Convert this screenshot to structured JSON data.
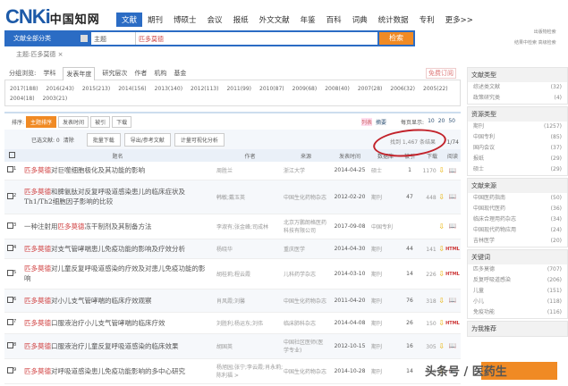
{
  "header": {
    "logo": "CNKi",
    "logo_cn": "中国知网",
    "nav": [
      "文献",
      "期刊",
      "博硕士",
      "会议",
      "报纸",
      "外文文献",
      "年鉴",
      "百科",
      "词典",
      "统计数据",
      "专利",
      "更多>>"
    ],
    "active_nav": "文献"
  },
  "search": {
    "category": "文献全部分类",
    "field": "主题",
    "query": "匹多莫德",
    "button": "检索",
    "links": [
      "出版物检索",
      "结果中检索",
      "高级检索"
    ]
  },
  "tag": "主题:匹多莫德 ×",
  "filter": {
    "label": "分组浏览:",
    "tabs": [
      "学科",
      "发表年度",
      "研究层次",
      "作者",
      "机构",
      "基金"
    ],
    "active": "发表年度",
    "years": [
      "2017(188)",
      "2016(243)",
      "2015(213)",
      "2014(156)",
      "2013(140)",
      "2012(113)",
      "2011(99)",
      "2010(87)",
      "2009(68)",
      "2008(40)",
      "2007(28)",
      "2006(32)",
      "2005(22)",
      "2004(18)",
      "2003(21)"
    ],
    "free": "免费订阅"
  },
  "sort": {
    "label": "排序:",
    "options": [
      "主题排序",
      "发表时间",
      "被引",
      "下载"
    ],
    "active": "主题排序",
    "view": [
      "列表",
      "摘要"
    ],
    "per_page_label": "每页显示:",
    "per_page": [
      "10",
      "20",
      "50"
    ]
  },
  "toolbar": {
    "selected": "已选文献: 0",
    "clear": "清除",
    "buttons": [
      "批量下载",
      "导出/参考文献",
      "计量可视化分析"
    ],
    "count": "找到 1,467 条结果",
    "page": "1/74"
  },
  "table": {
    "headers": [
      "题名",
      "作者",
      "来源",
      "发表时间",
      "数据库",
      "被引",
      "下载",
      "阅读"
    ],
    "rows": [
      {
        "n": "1",
        "kw": "匹多莫德",
        "title": "对巨噬细胞极化及其功能的影响",
        "author": "周胜兰",
        "source": "浙江大学",
        "date": "2014-04-25",
        "db": "硕士",
        "cite": "1",
        "dl": "1170",
        "read": "book"
      },
      {
        "n": "2",
        "kw": "匹多莫德",
        "title": "和脾氨肽对反复呼吸道感染患儿的临床症状及Th1/Th2细胞因子影响的比较",
        "author": "韩敏;戴玉英",
        "source": "中国生化药物杂志",
        "date": "2012-02-20",
        "db": "期刊",
        "cite": "47",
        "dl": "448",
        "read": "book"
      },
      {
        "n": "3",
        "pre": "一种注射用",
        "kw": "匹多莫德",
        "title": "冻干制剂及其制备方法",
        "author": "李淑有;张金峰;司成林",
        "source": "北京万鹏朗格医药科技有限公司",
        "date": "2017-09-08",
        "db": "中国专利",
        "cite": "",
        "dl": "",
        "read": "book"
      },
      {
        "n": "4",
        "kw": "匹多莫德",
        "title": "对支气管哮喘患儿免疫功能的影响及疗效分析",
        "author": "杨晓华",
        "source": "重庆医学",
        "date": "2014-04-30",
        "db": "期刊",
        "cite": "44",
        "dl": "141",
        "read": "HTML"
      },
      {
        "n": "5",
        "kw": "匹多莫德",
        "title": "对儿童反复呼吸道感染的疗效及对患儿免疫功能的影响",
        "author": "胡桂莉;程云霞",
        "source": "儿科药学杂志",
        "date": "2014-03-10",
        "db": "期刊",
        "cite": "14",
        "dl": "226",
        "read": "HTML"
      },
      {
        "n": "6",
        "kw": "匹多莫德",
        "title": "对小儿支气管哮喘的临床疗效观察",
        "author": "肖风霞;刘馨",
        "source": "中国生化药物杂志",
        "date": "2011-04-20",
        "db": "期刊",
        "cite": "76",
        "dl": "318",
        "read": "book"
      },
      {
        "n": "7",
        "kw": "匹多莫德",
        "title": "口服液治疗小儿支气管哮喘的临床疗效",
        "author": "刘胜利;杨运东;刘伟",
        "source": "临床肺科杂志",
        "date": "2014-04-08",
        "db": "期刊",
        "cite": "26",
        "dl": "150",
        "read": "HTML"
      },
      {
        "n": "8",
        "kw": "匹多莫德",
        "title": "口服液治疗儿童反复呼吸道感染的临床效果",
        "author": "胡国英",
        "source": "中国社区医师(医学专业)",
        "date": "2012-10-15",
        "db": "期刊",
        "cite": "16",
        "dl": "305",
        "read": "book"
      },
      {
        "n": "9",
        "kw": "匹多莫德",
        "title": "对呼吸道感染患儿免疫功能影响的多中心研究",
        "author": "杨旭园;张宁;李云霞;肖永莉;陈利福 >",
        "source": "中国生化药物杂志",
        "date": "2014-10-28",
        "db": "期刊",
        "cite": "14",
        "dl": "110",
        "read": "book"
      }
    ]
  },
  "sidebar": [
    {
      "title": "文献类型",
      "items": [
        [
          "综述类文献",
          "(32)"
        ],
        [
          "政策研究类",
          "(4)"
        ]
      ]
    },
    {
      "title": "资源类型",
      "items": [
        [
          "期刊",
          "(1257)"
        ],
        [
          "中国专利",
          "(85)"
        ],
        [
          "国内会议",
          "(37)"
        ],
        [
          "报纸",
          "(29)"
        ],
        [
          "硕士",
          "(29)"
        ]
      ]
    },
    {
      "title": "文献来源",
      "items": [
        [
          "中国医药指南",
          "(50)"
        ],
        [
          "中国现代医药",
          "(36)"
        ],
        [
          "临床合理用药杂志",
          "(34)"
        ],
        [
          "中国现代药物应用",
          "(24)"
        ],
        [
          "吉林医学",
          "(20)"
        ]
      ]
    },
    {
      "title": "关键词",
      "items": [
        [
          "匹多莫德",
          "(707)"
        ],
        [
          "反复呼吸道感染",
          "(206)"
        ],
        [
          "儿童",
          "(151)"
        ],
        [
          "小儿",
          "(118)"
        ],
        [
          "免疫功能",
          "(116)"
        ]
      ]
    },
    {
      "title": "为我推荐",
      "items": []
    }
  ],
  "watermark": "头条号 / 医药生"
}
